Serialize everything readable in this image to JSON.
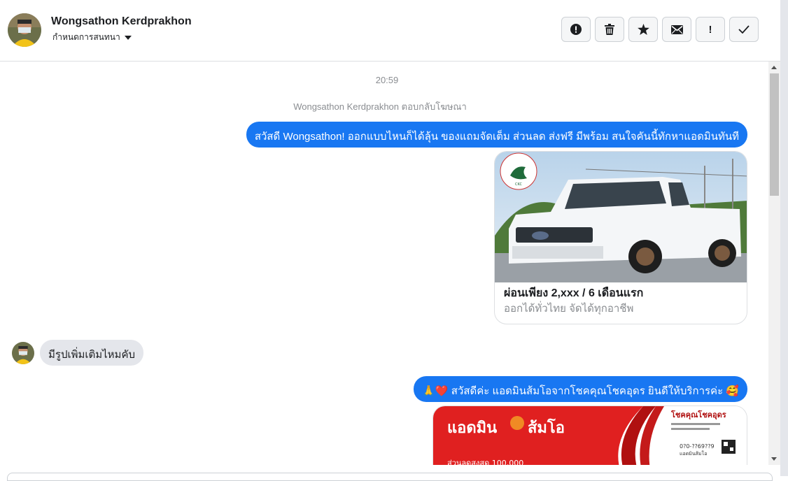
{
  "contact": {
    "name": "Wongsathon Kerdprakhon",
    "subtitle": "กำหนดการสนทนา"
  },
  "toolbar": {
    "buttons": [
      {
        "icon": "alert-circle-icon"
      },
      {
        "icon": "trash-icon"
      },
      {
        "icon": "star-icon"
      },
      {
        "icon": "envelope-icon"
      },
      {
        "icon": "exclamation-icon",
        "label": "!"
      },
      {
        "icon": "check-icon"
      }
    ]
  },
  "conversation": {
    "timestamp": "20:59",
    "reply_note": "Wongsathon Kerdprakhon ตอบกลับโฆษณา",
    "messages": [
      {
        "from": "page",
        "text": "สวัสดี Wongsathon! ออกแบบไหนก็ได้ลุ้น ของแถมจัดเต็ม ส่วนลด ส่งฟรี มีพร้อม สนใจคันนี้ทักหาแอดมินทันที"
      },
      {
        "from": "page",
        "card_title": "ผ่อนเพียง 2,xxx / 6 เดือนแรก",
        "card_subtitle": "ออกได้ทั่วไทย จัดได้ทุกอาชีพ"
      },
      {
        "from": "user",
        "text": "มีรูปเพิ่มเติมไหมคับ"
      },
      {
        "from": "page",
        "text": "🙏❤️ สวัสดีค่ะ แอดมินส้มโอจากโชคคุณโชคอุดร ยินดีให้บริการค่ะ 🥰"
      },
      {
        "from": "page",
        "image_text": {
          "brand": "แอดมิน",
          "brand2": "ส้มโอ",
          "shop": "โชคคุณโชคอุดร",
          "discount": "ส่วนลดสูงสุด 100,000",
          "phone": "0?0-??69??9",
          "handle": "แอดมินส้มโอ"
        }
      }
    ]
  },
  "colors": {
    "outgoing_bubble": "#1877f2",
    "incoming_bubble": "#e4e6eb",
    "accent_red": "#e02020"
  }
}
